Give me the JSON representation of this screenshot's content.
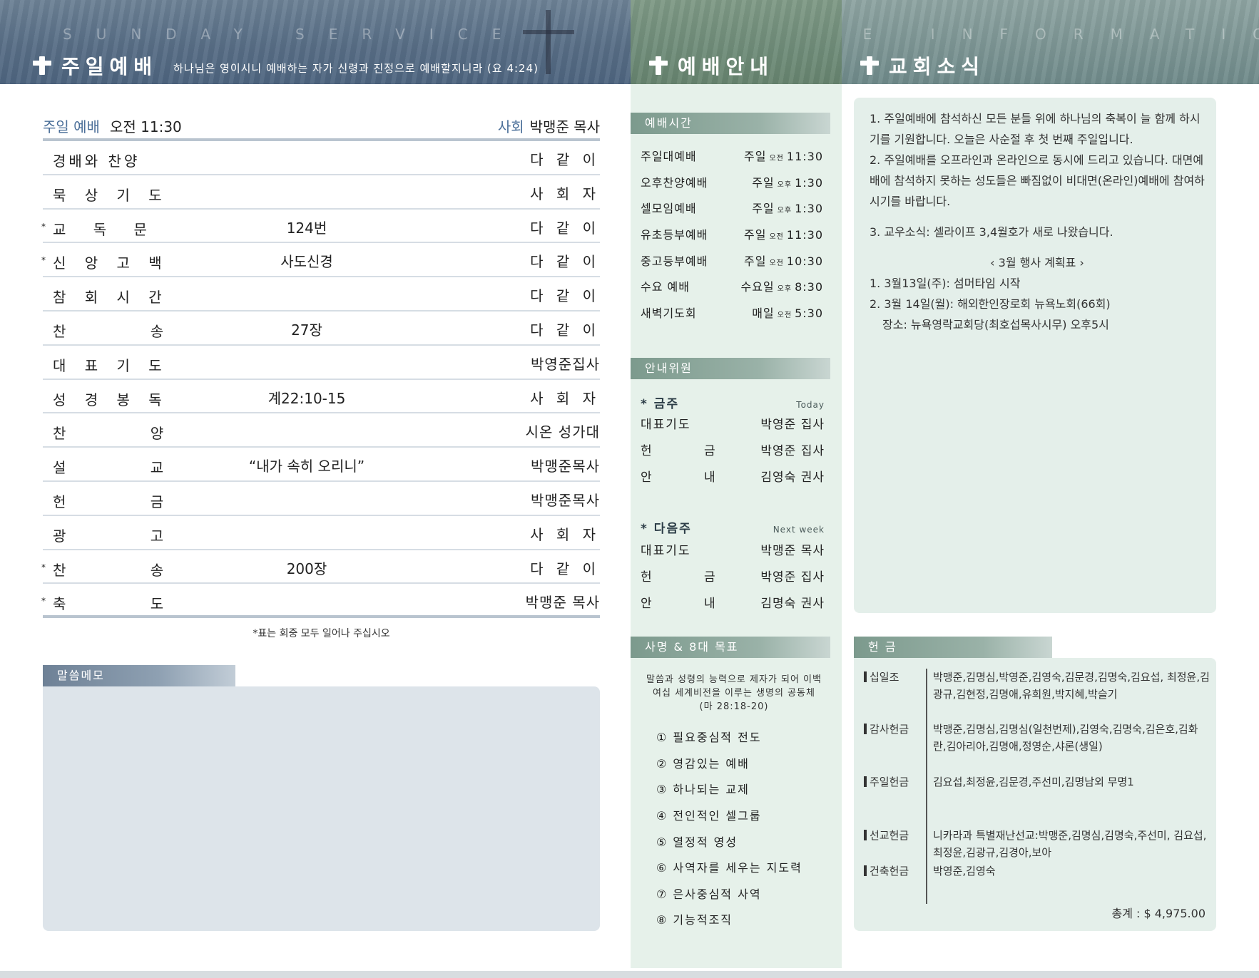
{
  "header": {
    "left_deco": "SUNDAY SERVICE",
    "left_title": "주일예배",
    "left_verse": "하나님은 영이시니 예배하는 자가 신령과 진정으로 예배할지니라 (요 4:24)",
    "mid_title": "예배안내",
    "right_title": "교회소식",
    "right_deco": "SERVICE INFORMATION"
  },
  "service": {
    "label_service": "주일 예배",
    "time": "오전 11:30",
    "label_host": "사회",
    "host": "박맹준 목사",
    "rows": [
      {
        "star": "",
        "name": "경배와 찬양",
        "mid": "",
        "who": "다 같 이"
      },
      {
        "star": "",
        "name": "묵 상 기 도",
        "mid": "",
        "who": "사 회 자"
      },
      {
        "star": "*",
        "name": "교 독 문",
        "mid": "124번",
        "who": "다 같 이"
      },
      {
        "star": "*",
        "name": "신 앙 고 백",
        "mid": "사도신경",
        "who": "다 같 이"
      },
      {
        "star": "",
        "name": "참 회 시 간",
        "mid": "",
        "who": "다 같 이"
      },
      {
        "star": "",
        "name": "찬 송",
        "mid": "27장",
        "who": "다 같 이"
      },
      {
        "star": "",
        "name": "대 표 기 도",
        "mid": "",
        "who": "박영준집사"
      },
      {
        "star": "",
        "name": "성 경 봉 독",
        "mid": "계22:10-15",
        "who": "사 회 자"
      },
      {
        "star": "",
        "name": "찬 양",
        "mid": "",
        "who": "시온 성가대"
      },
      {
        "star": "",
        "name": "설 교",
        "mid": "“내가 속히 오리니”",
        "who": "박맹준목사"
      },
      {
        "star": "",
        "name": "헌 금",
        "mid": "",
        "who": "박맹준목사"
      },
      {
        "star": "",
        "name": "광 고",
        "mid": "",
        "who": "사 회 자"
      },
      {
        "star": "*",
        "name": "찬 송",
        "mid": "200장",
        "who": "다 같 이"
      },
      {
        "star": "*",
        "name": "축 도",
        "mid": "",
        "who": "박맹준 목사"
      }
    ],
    "note": "*표는 회중 모두 일어나 주십시오"
  },
  "memo": {
    "title": "말씀메모"
  },
  "worship_times": {
    "title": "예배시간",
    "rows": [
      {
        "name": "주일대예배",
        "day": "주일",
        "ampm": "오전",
        "time": "11:30"
      },
      {
        "name": "오후찬양예배",
        "day": "주일",
        "ampm": "오후",
        "time": "1:30"
      },
      {
        "name": "셀모임예배",
        "day": "주일",
        "ampm": "오후",
        "time": "1:30"
      },
      {
        "name": "유초등부예배",
        "day": "주일",
        "ampm": "오전",
        "time": "11:30"
      },
      {
        "name": "중고등부예배",
        "day": "주일",
        "ampm": "오전",
        "time": "10:30"
      },
      {
        "name": "수요 예배",
        "day": "수요일",
        "ampm": "오후",
        "time": "8:30"
      },
      {
        "name": "새벽기도회",
        "day": "매일",
        "ampm": "오전",
        "time": "5:30"
      }
    ]
  },
  "ushers": {
    "title": "안내위원",
    "this_week": {
      "label": "* 금주",
      "en": "Today",
      "rows": [
        {
          "role": "대표기도",
          "person": "박영준 집사"
        },
        {
          "role": "헌 금",
          "person": "박영준 집사"
        },
        {
          "role": "안 내",
          "person": "김영숙 권사"
        }
      ]
    },
    "next_week": {
      "label": "* 다음주",
      "en": "Next week",
      "rows": [
        {
          "role": "대표기도",
          "person": "박맹준 목사"
        },
        {
          "role": "헌 금",
          "person": "박영준 집사"
        },
        {
          "role": "안 내",
          "person": "김명숙 권사"
        }
      ]
    }
  },
  "mission": {
    "title": "사명 & 8대 목표",
    "statement": "말씀과 성령의 능력으로 제자가 되어 이백 여십 세계비전을 이루는 생명의 공동체 (마 28:18-20)",
    "goals": [
      "① 필요중심적 전도",
      "② 영감있는 예배",
      "③ 하나되는 교제",
      "④ 전인적인 셀그룹",
      "⑤ 열정적 영성",
      "⑥ 사역자를 세우는 지도력",
      "⑦ 은사중심적 사역",
      "⑧ 기능적조직"
    ]
  },
  "news": {
    "p1": "1. 주일예배에 참석하신 모든 분들 위에 하나님의 축복이 늘 함께 하시기를 기원합니다. 오늘은 사순절 후 첫 번째 주일입니다.",
    "p2": "2. 주일예배를 오프라인과 온라인으로 동시에 드리고 있습니다. 대면예배에 참석하지 못하는 성도들은 빠짐없이 비대면(온라인)예배에 참여하시기를 바랍니다.",
    "p3": "3. 교우소식: 셀라이프 3,4월호가 새로 나왔습니다.",
    "plan_title": "‹  3월 행사 계획표  ›",
    "plan1": "1. 3월13일(주): 섬머타임 시작",
    "plan2": "2. 3월 14일(월): 해외한인장로회 뉴욕노회(66회)",
    "plan3": "장소: 뉴욕영락교회당(최호섭목사시무) 오후5시"
  },
  "offering": {
    "title": "헌 금",
    "rows": [
      {
        "kind": "십일조",
        "names": "박맹준,김명심,박영준,김영숙,김문경,김명숙,김요섭, 최정윤,김광규,김현정,김명애,유희원,박지혜,박슬기"
      },
      {
        "kind": "감사헌금",
        "names": "박맹준,김명심,김명심(일천번제),김영숙,김명숙,김은호,김화란,김아리아,김명애,정영순,샤론(생일)"
      },
      {
        "kind": "주일헌금",
        "names": "김요섭,최정윤,김문경,주선미,김명남외 무명1"
      },
      {
        "kind": "선교헌금",
        "names": "니카라과   특별재난선교:박맹준,김명심,김명숙,주선미, 김요섭,최정윤,김광규,김경아,보아"
      },
      {
        "kind": "건축헌금",
        "names": "박영준,김영숙"
      }
    ],
    "total_label": "총계 :",
    "total": "$  4,975.00"
  }
}
